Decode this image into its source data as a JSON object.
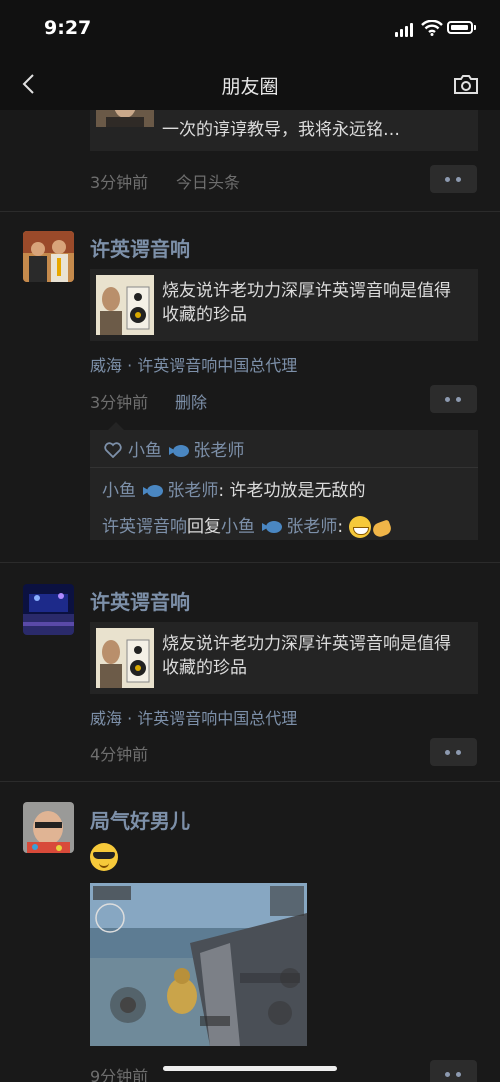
{
  "status_bar": {
    "time": "9:27"
  },
  "nav": {
    "title": "朋友圈"
  },
  "posts": [
    {
      "link_text": "一次的谆谆教导，我将永远铭…",
      "time": "3分钟前",
      "source": "今日头条"
    },
    {
      "username": "许英谔音响",
      "link_text": "烧友说许老功力深厚许英谔音响是值得收藏的珍品",
      "location": "威海 · 许英谔音响中国总代理",
      "time": "3分钟前",
      "delete_label": "删除",
      "likes": [
        "小鱼",
        "张老师"
      ],
      "comments": [
        {
          "author": "小鱼",
          "author_suffix": "张老师",
          "text": "许老功放是无敌的"
        },
        {
          "author": "许英谔音响",
          "reply_word": "回复",
          "target": "小鱼",
          "target_suffix": "张老师",
          "text": ""
        }
      ]
    },
    {
      "username": "许英谔音响",
      "link_text": "烧友说许老功力深厚许英谔音响是值得收藏的珍品",
      "location": "威海 · 许英谔音响中国总代理",
      "time": "4分钟前"
    },
    {
      "username": "局气好男儿",
      "time": "9分钟前"
    }
  ]
}
